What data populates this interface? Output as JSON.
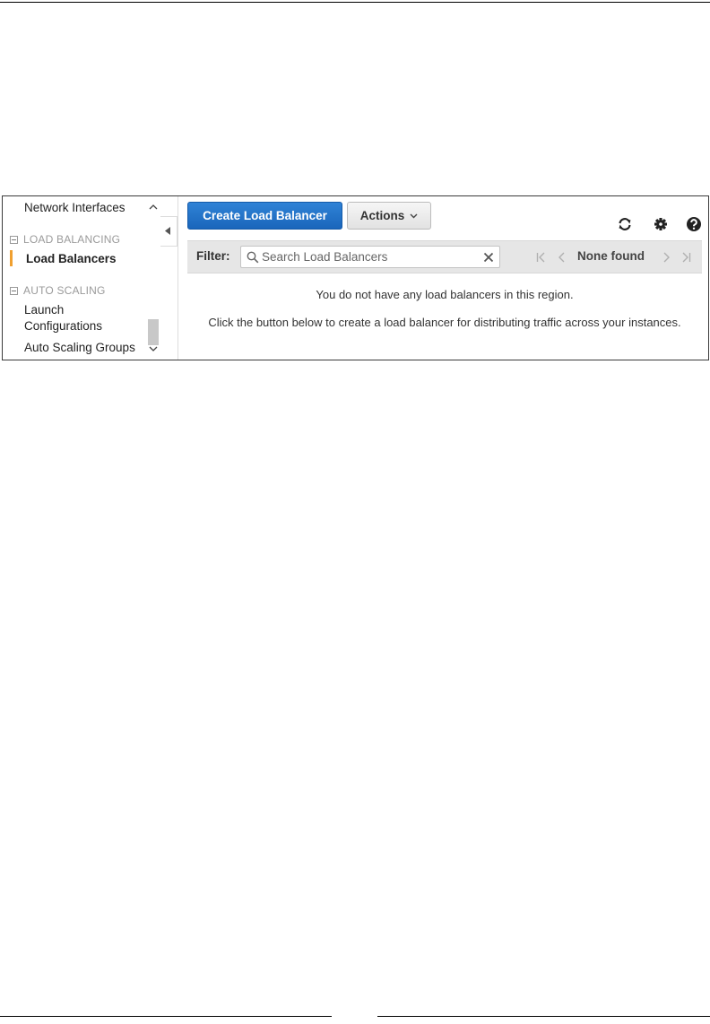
{
  "sidebar": {
    "network_interfaces": "Network Interfaces",
    "group_load_balancing": "LOAD BALANCING",
    "load_balancers": "Load Balancers",
    "group_auto_scaling": "AUTO SCALING",
    "launch_configurations_line1": "Launch",
    "launch_configurations_line2": "Configurations",
    "auto_scaling_groups": "Auto Scaling Groups"
  },
  "toolbar": {
    "create_label": "Create Load Balancer",
    "actions_label": "Actions"
  },
  "filter": {
    "label": "Filter:",
    "placeholder": "Search Load Balancers",
    "value": ""
  },
  "pager": {
    "status": "None found"
  },
  "empty_state": {
    "line1": "You do not have any load balancers in this region.",
    "line2": "Click the button below to create a load balancer for distributing traffic across your instances."
  },
  "colors": {
    "primary_button": "#1f6fc5",
    "active_indicator": "#f0a030",
    "filter_bar": "#e6e6e6"
  },
  "icons": [
    "refresh-icon",
    "gear-icon",
    "help-icon",
    "search-icon",
    "clear-icon",
    "first-page-icon",
    "prev-page-icon",
    "next-page-icon",
    "last-page-icon",
    "collapse-sidebar-icon"
  ]
}
